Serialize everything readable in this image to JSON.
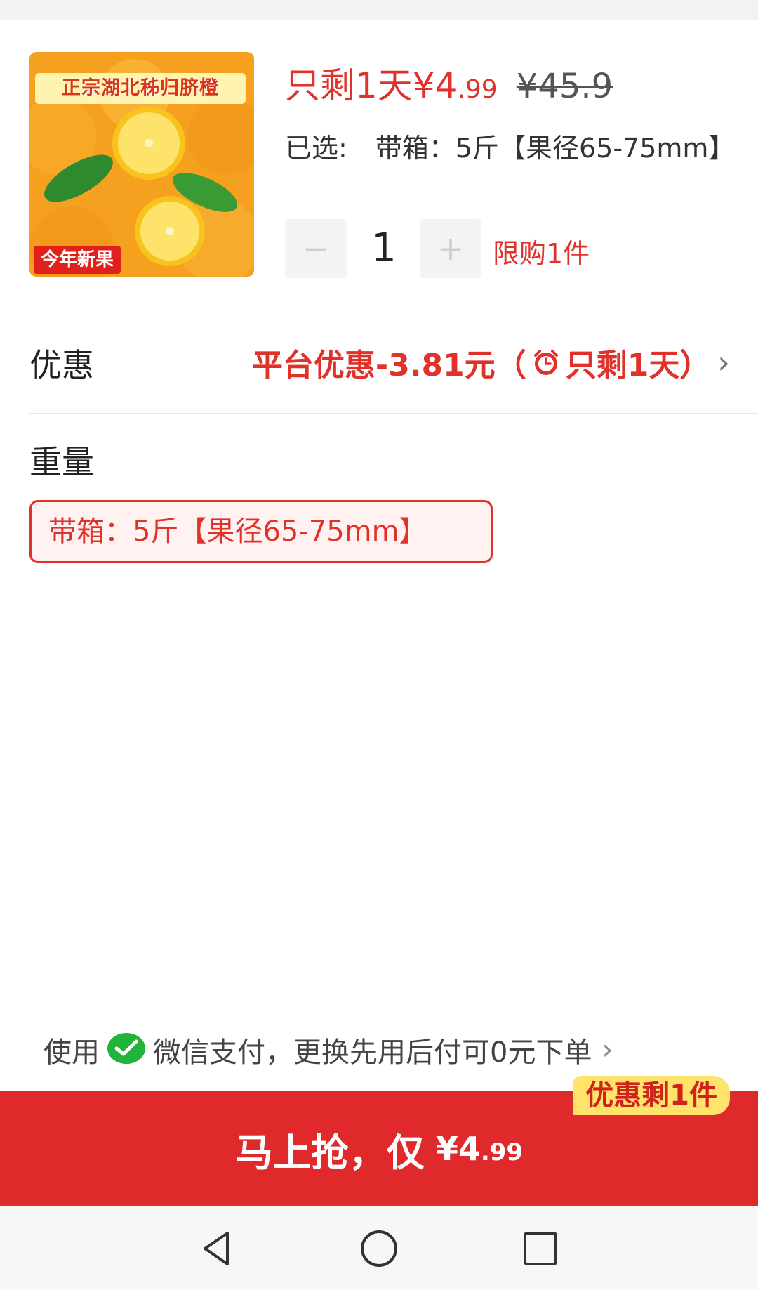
{
  "product": {
    "image_title": "正宗湖北秭归脐橙",
    "image_badge": "今年新果",
    "price_prefix": "只剩1天¥",
    "price_int": "4",
    "price_dec": ".99",
    "original_price": "¥45.9",
    "selected_label": "已选:",
    "selected_value": "带箱：5斤【果径65-75mm】",
    "quantity": "1",
    "minus": "−",
    "plus": "+",
    "limit": "限购1件"
  },
  "discount": {
    "label": "优惠",
    "value_main": "平台优惠-3.81元（",
    "value_time": "只剩1天）",
    "chevron": "›"
  },
  "weight": {
    "title": "重量",
    "option": "带箱：5斤【果径65-75mm】"
  },
  "payment": {
    "prefix": "使用",
    "text": "微信支付，更换先用后付可0元下单",
    "chevron": "›"
  },
  "buy": {
    "label": "马上抢，仅",
    "price_int": "¥4",
    "price_dec": ".99",
    "badge": "优惠剩1件",
    "color": "#e0292a"
  },
  "icons": [
    "clock-icon",
    "wechat-pay-icon",
    "back-icon",
    "home-icon",
    "recents-icon"
  ]
}
